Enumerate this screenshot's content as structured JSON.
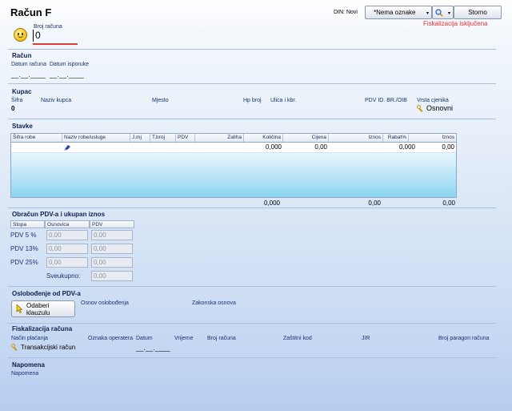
{
  "header": {
    "title": "Račun F",
    "din_label": "DIN: Novi",
    "oznake_select": "*Nema oznake",
    "storno_button": "Storno",
    "fiscal_status": "Fiskalizacija isključena",
    "broj_racuna_label": "Broj računa",
    "broj_racuna_value": "0"
  },
  "racun": {
    "section": "Račun",
    "datum_racuna_label": "Datum računa",
    "datum_isporuke_label": "Datum isporuke",
    "datum_racuna_value": "__.__.____",
    "datum_isporuke_value": "__.__.____"
  },
  "kupac": {
    "section": "Kupac",
    "labels": {
      "sifra": "Šifra",
      "naziv": "Naziv kupca",
      "mjesto": "Mjesto",
      "hp_broj": "Hp broj",
      "ulica": "Ulica i kbr.",
      "pdv_id": "PDV ID. BR./OIB",
      "vrsta_cjenika": "Vrsta cjenika"
    },
    "sifra_value": "0",
    "vrsta_cjenika_value": "Osnovni"
  },
  "stavke": {
    "section": "Stavke",
    "columns": [
      "Šifra robe",
      "Naziv robe/usluge",
      "J.mj",
      "T.broj",
      "PDV %",
      "Zaliha",
      "Količina",
      "Cijena",
      "Iznos",
      "Rabat%",
      "Iznos"
    ],
    "row": {
      "kolicina": "0,000",
      "cijena": "0,00",
      "rabat": "0,000",
      "iznos": "0,00"
    },
    "totals": {
      "kolicina": "0,000",
      "iznos": "0,00",
      "iznos2": "0,00"
    }
  },
  "obracun": {
    "section": "Obračun PDV-a i ukupan iznos",
    "headers": [
      "Stopa",
      "Osnovica",
      "PDV"
    ],
    "rows": [
      {
        "stopa": "PDV 5 %",
        "osnovica": "0,00",
        "pdv": "0,00"
      },
      {
        "stopa": "PDV 13%",
        "osnovica": "0,00",
        "pdv": "0,00"
      },
      {
        "stopa": "PDV 25%",
        "osnovica": "0,00",
        "pdv": "0,00"
      }
    ],
    "sveukupno_label": "Sveukupno:",
    "sveukupno_value": "0,00"
  },
  "oslobodjenje": {
    "section": "Oslobođenje od PDV-a",
    "button": "Odaberi klauzulu",
    "osnov_label": "Osnov oslobođenja",
    "zakonska_label": "Zakonska osnova"
  },
  "fiskalizacija": {
    "section": "Fiskalizacija računa",
    "labels": {
      "nacin": "Način plaćanja",
      "oznaka": "Oznaka operatera",
      "datum": "Datum",
      "vrijeme": "Vrijeme",
      "broj": "Broj računa",
      "zastitni": "Zaštitni kod",
      "jir": "JIR",
      "paragon": "Broj paragon računa"
    },
    "nacin_value": "Transakcijski račun",
    "datum_value": "__.__.____"
  },
  "napomena": {
    "section": "Napomena",
    "label": "Napomena"
  }
}
